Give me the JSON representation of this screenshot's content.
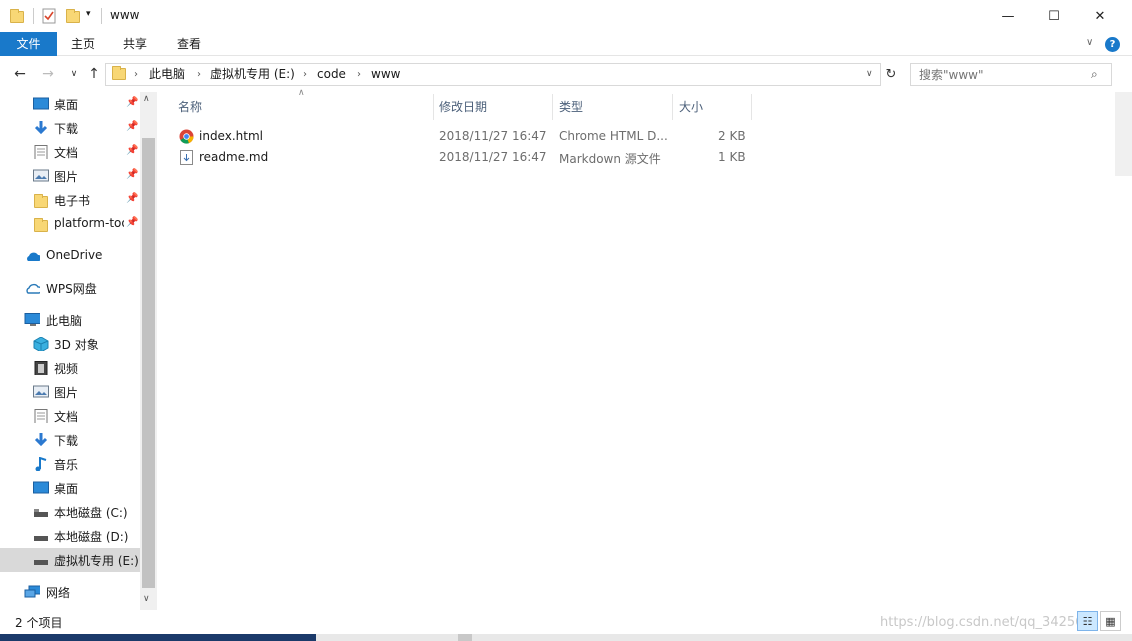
{
  "window": {
    "title": "www",
    "minimize": "—",
    "maximize": "☐",
    "close": "✕"
  },
  "ribbon": {
    "tabs": [
      {
        "label": "文件"
      },
      {
        "label": "主页"
      },
      {
        "label": "共享"
      },
      {
        "label": "查看"
      }
    ]
  },
  "address": {
    "breadcrumbs": [
      {
        "label": "此电脑"
      },
      {
        "label": "虚拟机专用 (E:)"
      },
      {
        "label": "code"
      },
      {
        "label": "www"
      }
    ]
  },
  "search": {
    "placeholder": "搜索\"www\""
  },
  "sidebar": {
    "quick_access": [
      {
        "label": "桌面",
        "icon": "desktop-icon",
        "pinned": true
      },
      {
        "label": "下载",
        "icon": "download-icon",
        "pinned": true
      },
      {
        "label": "文档",
        "icon": "document-icon",
        "pinned": true
      },
      {
        "label": "图片",
        "icon": "picture-icon",
        "pinned": true
      },
      {
        "label": "电子书",
        "icon": "folder-icon",
        "pinned": true
      },
      {
        "label": "platform-too",
        "icon": "folder-icon",
        "pinned": true
      }
    ],
    "onedrive": "OneDrive",
    "wps": "WPS网盘",
    "this_pc": "此电脑",
    "pc_items": [
      {
        "label": "3D 对象",
        "icon": "cube-icon"
      },
      {
        "label": "视频",
        "icon": "video-icon"
      },
      {
        "label": "图片",
        "icon": "picture-icon"
      },
      {
        "label": "文档",
        "icon": "document-icon"
      },
      {
        "label": "下载",
        "icon": "download-icon"
      },
      {
        "label": "音乐",
        "icon": "music-icon"
      },
      {
        "label": "桌面",
        "icon": "desktop-icon"
      },
      {
        "label": "本地磁盘 (C:)",
        "icon": "drive-icon"
      },
      {
        "label": "本地磁盘 (D:)",
        "icon": "drive-icon"
      },
      {
        "label": "虚拟机专用 (E:)",
        "icon": "drive-icon",
        "selected": true
      }
    ],
    "network": "网络"
  },
  "columns": {
    "name": "名称",
    "modified": "修改日期",
    "type": "类型",
    "size": "大小"
  },
  "files": [
    {
      "name": "index.html",
      "modified": "2018/11/27 16:47",
      "type": "Chrome HTML D...",
      "size": "2 KB",
      "icon": "chrome-icon"
    },
    {
      "name": "readme.md",
      "modified": "2018/11/27 16:47",
      "type": "Markdown 源文件",
      "size": "1 KB",
      "icon": "markdown-file-icon"
    }
  ],
  "status": {
    "item_count": "2 个项目"
  },
  "watermark": "https://blog.csdn.net/qq_34256...",
  "colors": {
    "accent": "#1979ca",
    "selected": "#cce8ff",
    "header_text": "#4c607a"
  }
}
